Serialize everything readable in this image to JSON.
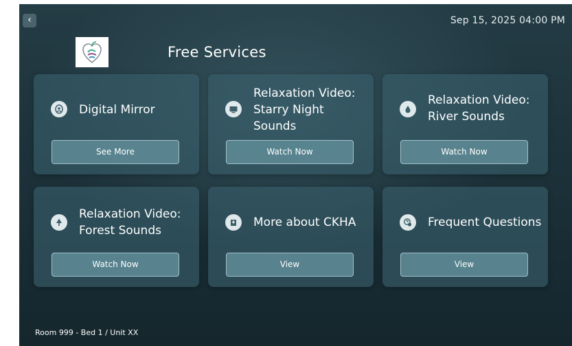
{
  "header": {
    "back_icon": "chevron-left-icon",
    "back_glyph": "‹",
    "datetime": "Sep 15, 2025  04:00 PM",
    "logo_icon": "heart-leaf-logo",
    "title": "Free Services"
  },
  "cards": [
    {
      "title_lines": [
        "Digital Mirror"
      ],
      "icon": "mirror-person-icon",
      "button_label": "See More"
    },
    {
      "title_lines": [
        "Relaxation Video:",
        "Starry Night",
        "Sounds"
      ],
      "icon": "tv-screen-icon",
      "button_label": "Watch Now"
    },
    {
      "title_lines": [
        "Relaxation Video:",
        "River Sounds"
      ],
      "icon": "water-drop-icon",
      "button_label": "Watch Now"
    },
    {
      "title_lines": [
        "Relaxation Video:",
        "Forest Sounds"
      ],
      "icon": "tree-icon",
      "button_label": "Watch Now"
    },
    {
      "title_lines": [
        "More about CKHA"
      ],
      "icon": "hospital-building-icon",
      "button_label": "View"
    },
    {
      "title_lines": [
        "Frequent Questions"
      ],
      "icon": "question-chat-icon",
      "button_label": "View"
    }
  ],
  "footer": {
    "location": "Room 999  -  Bed  1 / Unit XX"
  },
  "colors": {
    "panel_dark": "#1d333b",
    "card": "#38606c",
    "button": "#5f8c98",
    "text": "#ffffff"
  }
}
